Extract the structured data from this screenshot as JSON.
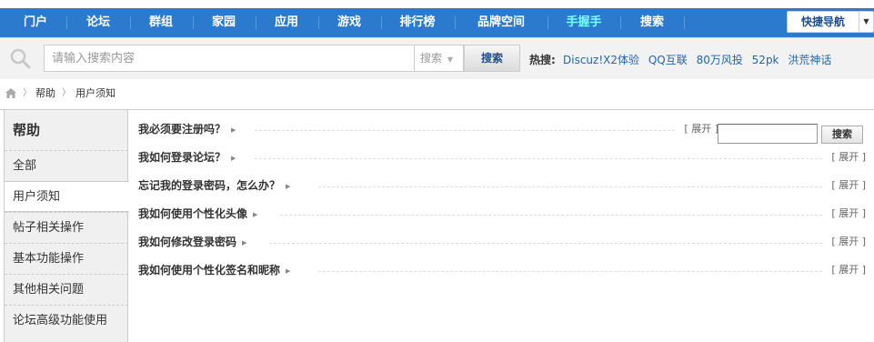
{
  "nav": {
    "items": [
      {
        "label": "门户"
      },
      {
        "label": "论坛"
      },
      {
        "label": "群组"
      },
      {
        "label": "家园"
      },
      {
        "label": "应用"
      },
      {
        "label": "游戏"
      },
      {
        "label": "排行榜"
      },
      {
        "label": "品牌空间"
      },
      {
        "label": "手握手",
        "highlight_color": "#77ffff"
      },
      {
        "label": "搜索"
      }
    ],
    "quick_nav_label": "快捷导航",
    "bg_color": "#2b7acd"
  },
  "search": {
    "placeholder": "请输入搜索内容",
    "type_label": "搜索",
    "button_label": "搜索",
    "hot_label": "热搜:",
    "hot_links": [
      "Discuz!X2体验",
      "QQ互联",
      "80万风投",
      "52pk",
      "洪荒神话"
    ]
  },
  "breadcrumb": {
    "items": [
      "帮助",
      "用户须知"
    ]
  },
  "sidebar": {
    "title": "帮助",
    "items": [
      {
        "label": "全部",
        "active": false
      },
      {
        "label": "用户须知",
        "active": true
      },
      {
        "label": "帖子相关操作",
        "active": false
      },
      {
        "label": "基本功能操作",
        "active": false
      },
      {
        "label": "其他相关问题",
        "active": false
      },
      {
        "label": "论坛高级功能使用",
        "active": false
      }
    ]
  },
  "faq": {
    "expand_label": "[ 展开 ]",
    "search_button_label": "搜索",
    "questions": [
      "我必须要注册吗？",
      "我如何登录论坛？",
      "忘记我的登录密码，怎么办？",
      "我如何使用个性化头像",
      "我如何修改登录密码",
      "我如何使用个性化签名和昵称"
    ]
  }
}
